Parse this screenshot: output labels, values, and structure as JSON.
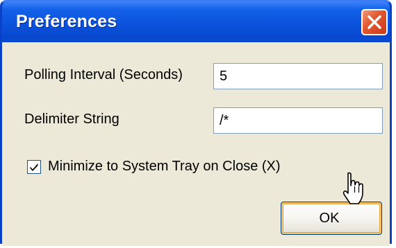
{
  "window": {
    "title": "Preferences"
  },
  "fields": {
    "polling_interval": {
      "label": "Polling Interval (Seconds)",
      "value": "5"
    },
    "delimiter": {
      "label": "Delimiter String",
      "value": "/*"
    }
  },
  "options": {
    "minimize_tray": {
      "label": "Minimize to System Tray on Close (X)",
      "checked": true
    }
  },
  "buttons": {
    "ok_label": "OK"
  },
  "icons": {
    "close": "close-icon",
    "check": "checkmark-icon",
    "cursor": "mouse-pointer-icon"
  },
  "colors": {
    "titlebar": "#0a4fd6",
    "client": "#ece9d8",
    "close_button": "#e25a32"
  }
}
